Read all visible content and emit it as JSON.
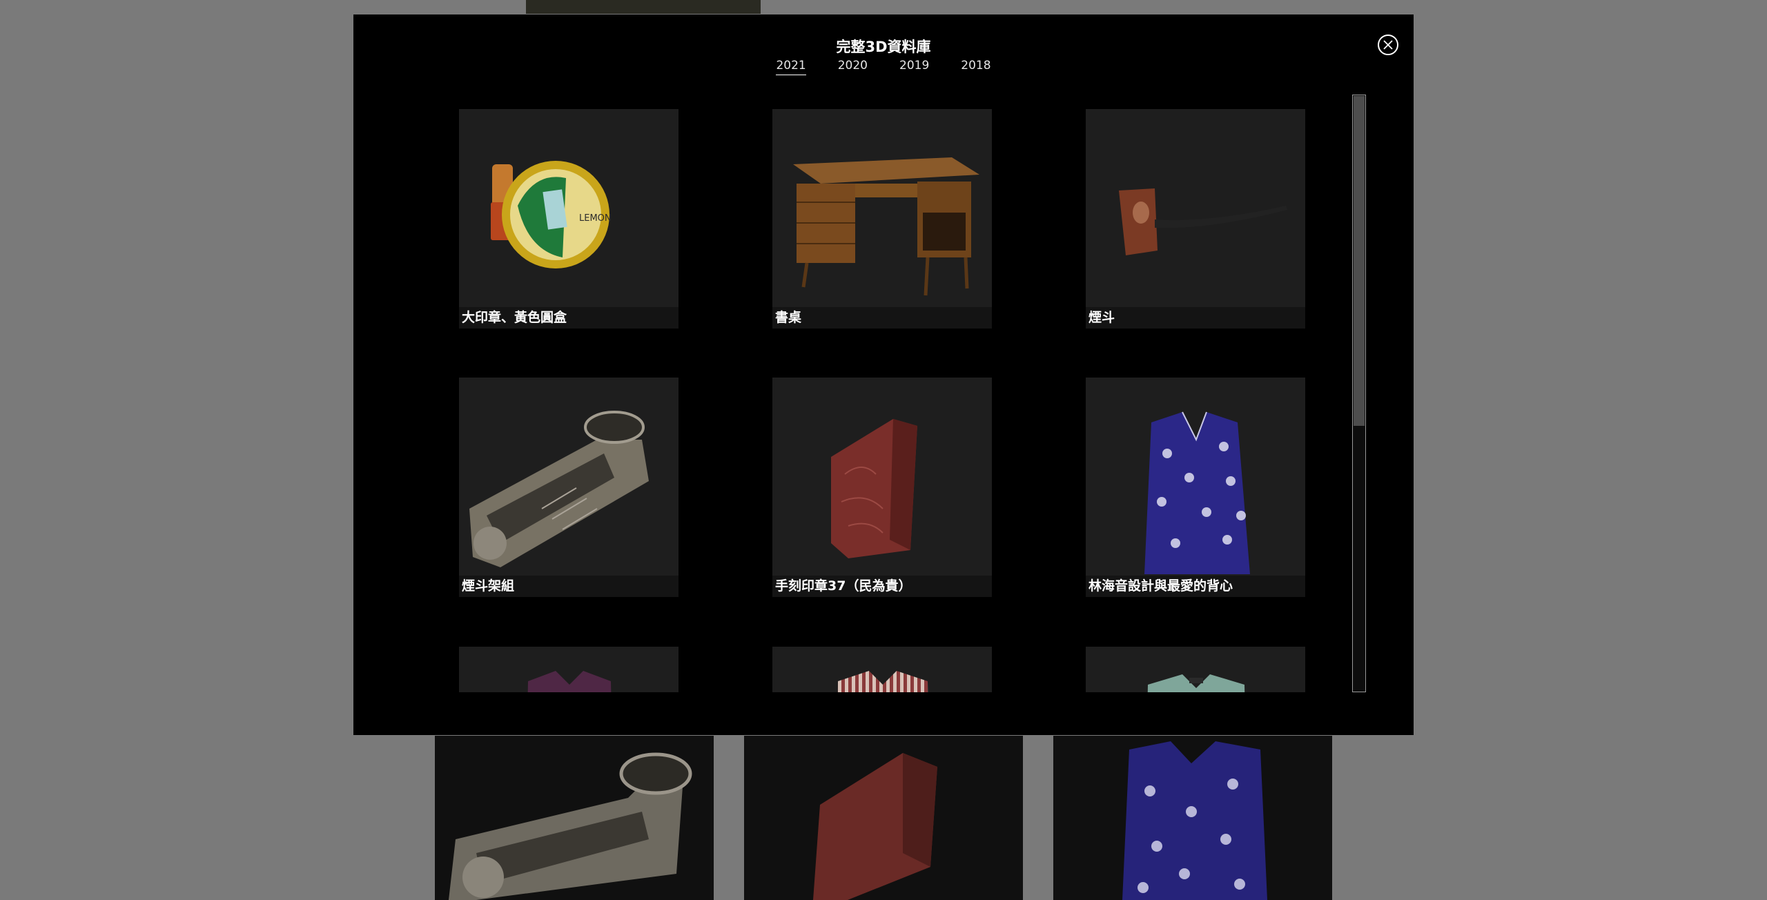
{
  "modal": {
    "title": "完整3D資料庫",
    "years": [
      "2021",
      "2020",
      "2019",
      "2018"
    ],
    "active_year": "2021"
  },
  "items": [
    {
      "caption": "大印章、黃色圓盒",
      "icon": "stamp-and-tin-thumbnail",
      "tin_text": "LEMON"
    },
    {
      "caption": "書桌",
      "icon": "desk-thumbnail"
    },
    {
      "caption": "煙斗",
      "icon": "pipe-thumbnail"
    },
    {
      "caption": "煙斗架組",
      "icon": "pipe-rack-thumbnail"
    },
    {
      "caption": "手刻印章37（民為貴）",
      "icon": "carved-seal-thumbnail"
    },
    {
      "caption": "林海音設計與最愛的背心",
      "icon": "blue-vest-thumbnail"
    },
    {
      "caption": "",
      "icon": "purple-garment-thumbnail"
    },
    {
      "caption": "",
      "icon": "striped-garment-thumbnail"
    },
    {
      "caption": "",
      "icon": "green-garment-thumbnail"
    }
  ],
  "colors": {
    "overlay": "#7a7a7a",
    "modal_bg": "#000000",
    "tile_bg": "#1e1e1e",
    "text": "#ffffff"
  }
}
